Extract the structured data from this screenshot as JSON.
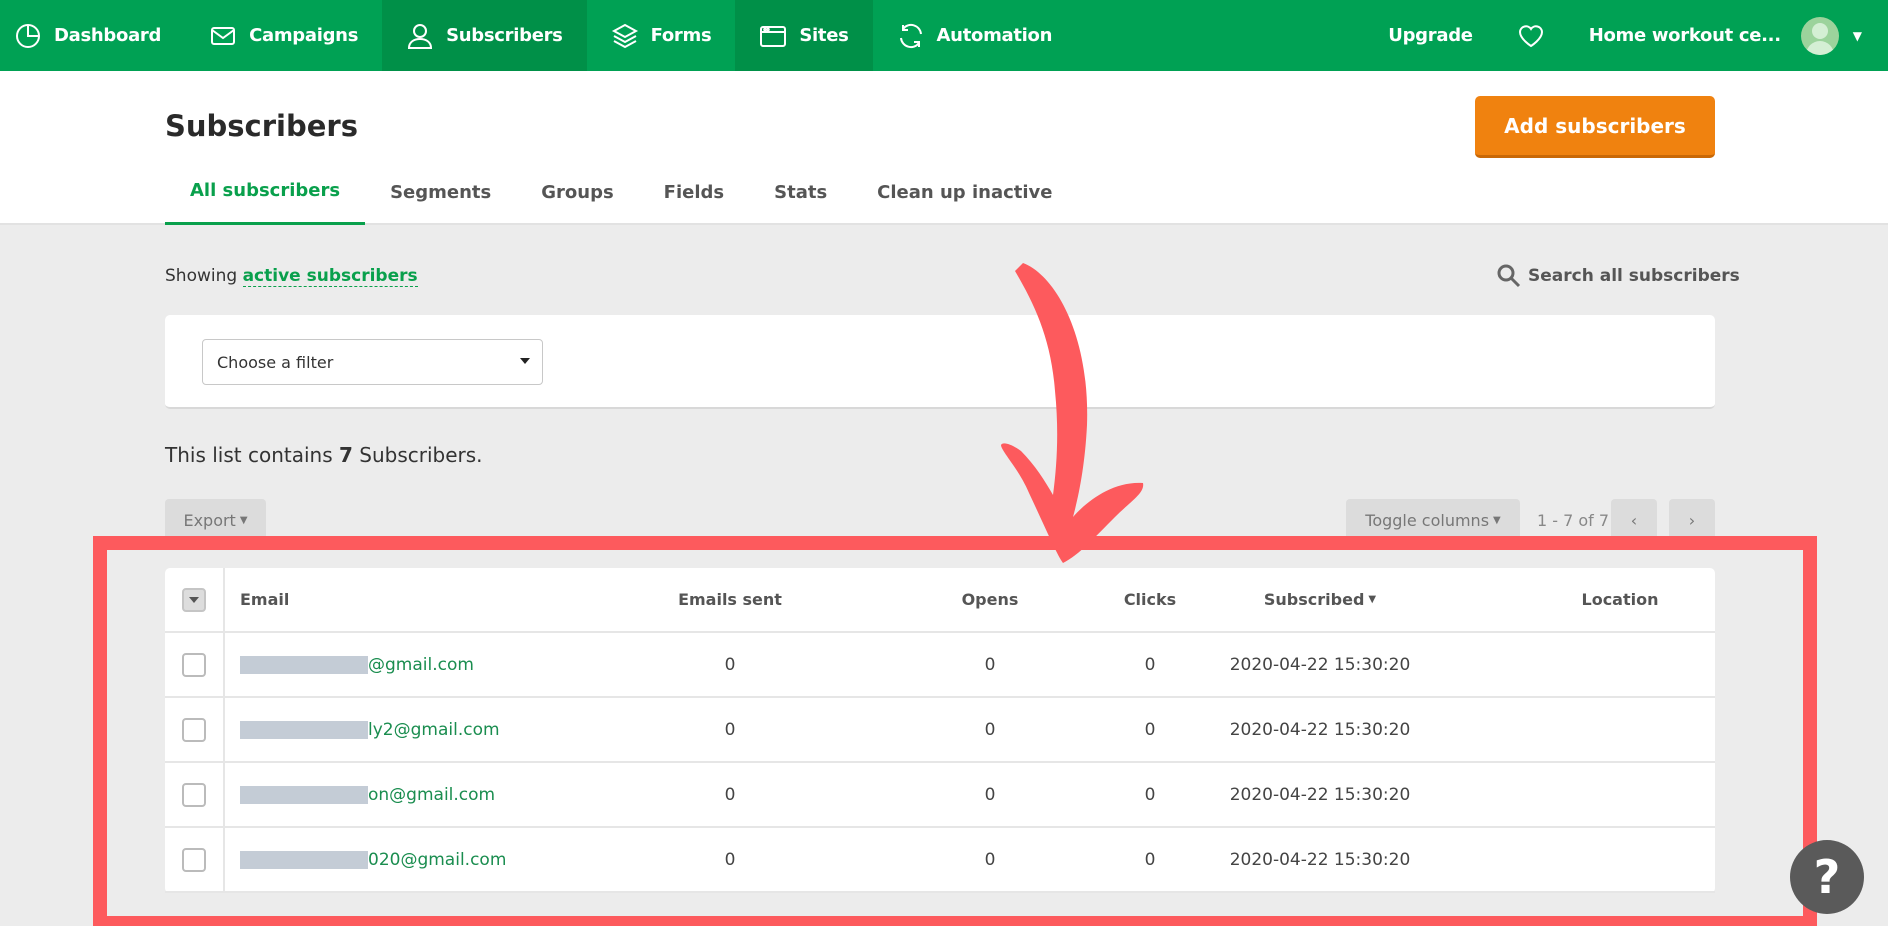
{
  "nav": {
    "items": [
      {
        "label": "Dashboard",
        "icon": "dashboard-icon"
      },
      {
        "label": "Campaigns",
        "icon": "mail-icon"
      },
      {
        "label": "Subscribers",
        "icon": "user-icon"
      },
      {
        "label": "Forms",
        "icon": "layers-icon"
      },
      {
        "label": "Sites",
        "icon": "browser-icon"
      },
      {
        "label": "Automation",
        "icon": "refresh-icon"
      }
    ],
    "upgrade": "Upgrade",
    "account": "Home workout ce...",
    "brand_color": "#00a154"
  },
  "header": {
    "title": "Subscribers",
    "add_button": "Add subscribers",
    "tabs": [
      "All subscribers",
      "Segments",
      "Groups",
      "Fields",
      "Stats",
      "Clean up inactive"
    ],
    "active_tab": "All subscribers"
  },
  "toolbar": {
    "showing_prefix": "Showing",
    "showing_link": "active subscribers",
    "search_label": "Search all subscribers",
    "filter_placeholder": "Choose a filter",
    "list_prefix": "This list contains",
    "list_count": "7",
    "list_suffix": "Subscribers.",
    "export": "Export",
    "toggle_columns": "Toggle columns",
    "pagination": "1 - 7 of 7"
  },
  "table": {
    "headers": [
      "Email",
      "Emails sent",
      "Opens",
      "Clicks",
      "Subscribed",
      "Location"
    ],
    "rows": [
      {
        "email": "gmail.com",
        "at": "@",
        "sent": "0",
        "opens": "0",
        "clicks": "0",
        "subscribed": "2020-04-22 15:30:20",
        "location": ""
      },
      {
        "email": "ly2@gmail.com",
        "at": "",
        "sent": "0",
        "opens": "0",
        "clicks": "0",
        "subscribed": "2020-04-22 15:30:20",
        "location": ""
      },
      {
        "email": "on@gmail.com",
        "at": "",
        "sent": "0",
        "opens": "0",
        "clicks": "0",
        "subscribed": "2020-04-22 15:30:20",
        "location": ""
      },
      {
        "email": "020@gmail.com",
        "at": "",
        "sent": "0",
        "opens": "0",
        "clicks": "0",
        "subscribed": "2020-04-22 15:30:20",
        "location": ""
      }
    ]
  },
  "help": "?",
  "annotation_color": "#fd5a5d",
  "accent_color": "#f0820f"
}
